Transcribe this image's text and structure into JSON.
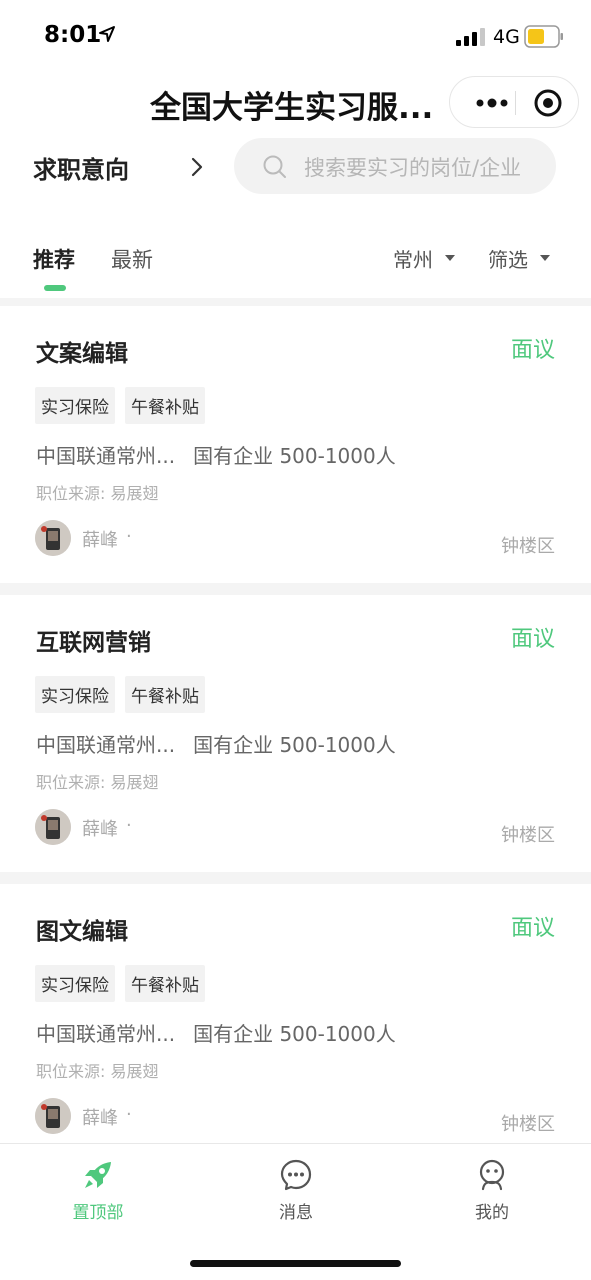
{
  "status_bar": {
    "time": "8:01",
    "network": "4G"
  },
  "title_bar": {
    "title": "全国大学生实习服..."
  },
  "search_row": {
    "intent_label": "求职意向",
    "search_placeholder": "搜索要实习的岗位/企业"
  },
  "tabs": [
    {
      "label": "推荐",
      "active": true
    },
    {
      "label": "最新",
      "active": false
    }
  ],
  "filters": {
    "city": "常州",
    "screen": "筛选"
  },
  "jobs": [
    {
      "title": "文案编辑",
      "salary": "面议",
      "tags": [
        "实习保险",
        "午餐补贴"
      ],
      "company": "中国联通常州...",
      "company_type": "国有企业",
      "company_size": "500-1000人",
      "source": "职位来源: 易展翅",
      "recruiter": "薛峰",
      "dot": "·",
      "district": "钟楼区"
    },
    {
      "title": "互联网营销",
      "salary": "面议",
      "tags": [
        "实习保险",
        "午餐补贴"
      ],
      "company": "中国联通常州...",
      "company_type": "国有企业",
      "company_size": "500-1000人",
      "source": "职位来源: 易展翅",
      "recruiter": "薛峰",
      "dot": "·",
      "district": "钟楼区"
    },
    {
      "title": "图文编辑",
      "salary": "面议",
      "tags": [
        "实习保险",
        "午餐补贴"
      ],
      "company": "中国联通常州...",
      "company_type": "国有企业",
      "company_size": "500-1000人",
      "source": "职位来源: 易展翅",
      "recruiter": "薛峰",
      "dot": "·",
      "district": "钟楼区"
    }
  ],
  "bottom_nav": [
    {
      "label": "置顶部",
      "icon": "rocket-icon",
      "active": true
    },
    {
      "label": "消息",
      "icon": "message-icon",
      "active": false
    },
    {
      "label": "我的",
      "icon": "profile-icon",
      "active": false
    }
  ],
  "colors": {
    "accent": "#4fc87d",
    "text": "#222222",
    "muted": "#aaaaaa",
    "gap": "#f4f4f4"
  }
}
